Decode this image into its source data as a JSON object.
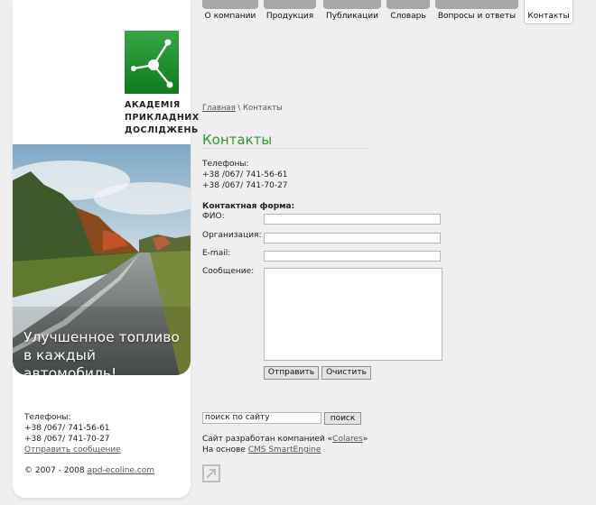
{
  "nav": {
    "tabs": [
      {
        "label": "О компании"
      },
      {
        "label": "Продукция"
      },
      {
        "label": "Публикации"
      },
      {
        "label": "Словарь"
      },
      {
        "label": "Вопросы и ответы"
      },
      {
        "label": "Контакты",
        "active": true
      }
    ]
  },
  "logo": {
    "line1": "АКАДЕМІЯ",
    "line2": "ПРИКЛАДНИХ",
    "line3": "ДОСЛІДЖЕНЬ",
    "icon": "molecule-icon"
  },
  "banner": {
    "line1": "Улучшенное топливо",
    "line2": "в каждый автомобиль!"
  },
  "left_contacts": {
    "phones_label": "Телефоны:",
    "phone1": "+38 /067/ 741-56-61",
    "phone2": "+38 /067/ 741-70-27",
    "send_link": "Отправить сообщение",
    "copyright_prefix": "© 2007 - 2008",
    "copyright_link": "apd-ecoline.com"
  },
  "breadcrumb": {
    "home": "Главная",
    "separator": " \\ ",
    "current": "Контакты"
  },
  "page_title": "Контакты",
  "phones": {
    "label": "Телефоны:",
    "phone1": "+38 /067/ 741-56-61",
    "phone2": "+38 /067/ 741-70-27"
  },
  "form": {
    "title": "Контактная форма:",
    "fio_label": "ФИО:",
    "org_label": "Организация:",
    "email_label": "E-mail:",
    "message_label": "Сообщение:",
    "submit_label": "Отправить",
    "clear_label": "Очистить"
  },
  "search": {
    "value": "поиск по сайту",
    "button_label": "поиск"
  },
  "credits": {
    "line1_prefix": "Сайт разработан компанией «",
    "line1_link": "Colares",
    "line1_suffix": "»",
    "line2_prefix": "На основе ",
    "line2_link": "CMS SmartEngine"
  },
  "colors": {
    "accent_green": "#2f9a2f",
    "tab_gray": "#a7a7a7",
    "background": "#efefef"
  }
}
